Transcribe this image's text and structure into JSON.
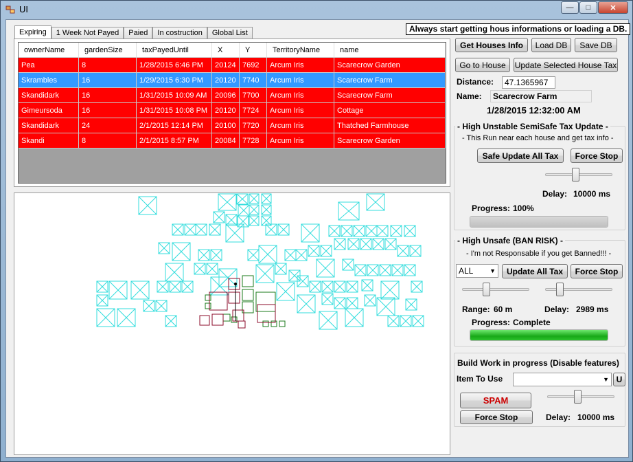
{
  "window": {
    "title": "UI",
    "controls": {
      "minimize": "—",
      "maximize": "□",
      "close": "✕"
    }
  },
  "colors": {
    "row_red": "#ff0000",
    "row_selected": "#3399ff",
    "map_cyan": "#33dddd",
    "map_darkred": "#8b0b2a",
    "map_green": "#1a7a1a",
    "progress_green": "#22b822",
    "spam_red": "#cc0000"
  },
  "tabs": [
    {
      "label": "Expiring",
      "active": true
    },
    {
      "label": "1 Week Not Payed"
    },
    {
      "label": "Paied"
    },
    {
      "label": "In costruction"
    },
    {
      "label": "Global List"
    }
  ],
  "notice": "Always start getting hous informations or loading a DB.",
  "table": {
    "columns": [
      "ownerName",
      "gardenSize",
      "taxPayedUntil",
      "X",
      "Y",
      "TerritoryName",
      "name"
    ],
    "rows": [
      {
        "ownerName": "Pea",
        "gardenSize": "8",
        "taxPayedUntil": "1/28/2015 6:46 PM",
        "X": "20124",
        "Y": "7692",
        "TerritoryName": "Arcum Iris",
        "name": "Scarecrow Garden",
        "selected": false
      },
      {
        "ownerName": "Skrambles",
        "gardenSize": "16",
        "taxPayedUntil": "1/29/2015 6:30 PM",
        "X": "20120",
        "Y": "7740",
        "TerritoryName": "Arcum Iris",
        "name": "Scarecrow Farm",
        "selected": true
      },
      {
        "ownerName": "Skandidark",
        "gardenSize": "16",
        "taxPayedUntil": "1/31/2015 10:09 AM",
        "X": "20096",
        "Y": "7700",
        "TerritoryName": "Arcum Iris",
        "name": "Scarecrow Farm",
        "selected": false
      },
      {
        "ownerName": "Gimeursoda",
        "gardenSize": "16",
        "taxPayedUntil": "1/31/2015 10:08 PM",
        "X": "20120",
        "Y": "7724",
        "TerritoryName": "Arcum Iris",
        "name": "Cottage",
        "selected": false
      },
      {
        "ownerName": "Skandidark",
        "gardenSize": "24",
        "taxPayedUntil": "2/1/2015 12:14 PM",
        "X": "20100",
        "Y": "7720",
        "TerritoryName": "Arcum Iris",
        "name": "Thatched Farmhouse",
        "selected": false
      },
      {
        "ownerName": "Skandi",
        "gardenSize": "8",
        "taxPayedUntil": "2/1/2015 8:57 PM",
        "X": "20084",
        "Y": "7728",
        "TerritoryName": "Arcum Iris",
        "name": "Scarecrow Garden",
        "selected": false
      }
    ]
  },
  "top_buttons": {
    "get_houses": "Get Houses Info",
    "load_db": "Load DB",
    "save_db": "Save DB",
    "go_to_house": "Go to House",
    "update_selected": "Update Selected House Tax"
  },
  "info": {
    "distance_label": "Distance:",
    "distance_value": "47.1365967",
    "name_label": "Name:",
    "name_value": "Scarecrow Farm",
    "datetime": "1/28/2015 12:32:00 AM"
  },
  "semisafe": {
    "title": "- High Unstable SemiSafe Tax Update -",
    "subtitle": "- This Run near each house and get tax info -",
    "update_button": "Safe Update All Tax",
    "stop_button": "Force Stop",
    "delay_label": "Delay:",
    "delay_value": "10000 ms",
    "delay_slider": 0.45,
    "progress_label": "Progress:",
    "progress_text": "100%",
    "progress": 1.0
  },
  "unsafe": {
    "title": "- High Unsafe (BAN RISK) -",
    "subtitle": "- I'm not Responsable if you get Banned!!! -",
    "select_value": "ALL",
    "update_button": "Update All Tax",
    "stop_button": "Force Stop",
    "range_label": "Range:",
    "range_value": "60 m",
    "range_slider": 0.35,
    "delay_label": "Delay:",
    "delay_value": "2989 ms",
    "delay_slider": 0.18,
    "progress_label": "Progress:",
    "progress_text": "Complete",
    "progress": 1.0
  },
  "build": {
    "title": "Build Work in progress (Disable features)",
    "item_label": "Item To Use",
    "item_value": "",
    "u_button": "U",
    "spam_button": "SPAM",
    "stop_button": "Force Stop",
    "delay_label": "Delay:",
    "delay_value": "10000 ms",
    "delay_slider": 0.45
  }
}
